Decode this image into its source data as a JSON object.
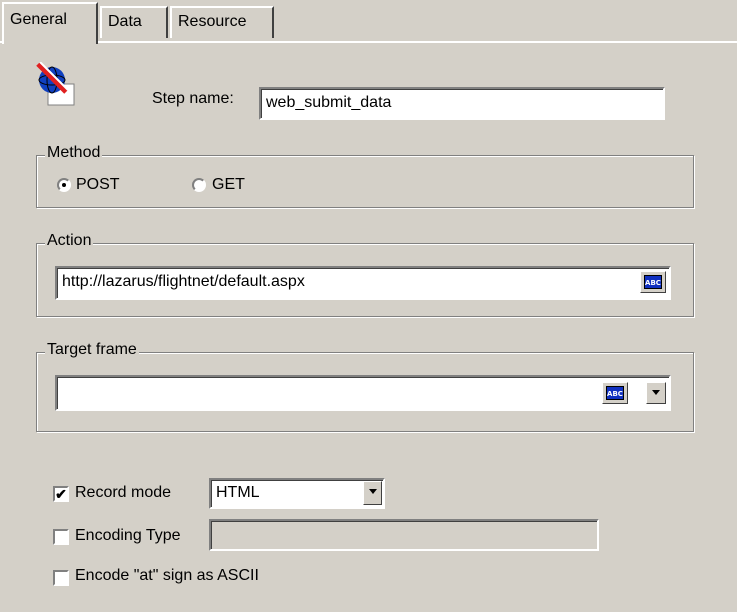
{
  "tabs": [
    "General",
    "Data",
    "Resource"
  ],
  "step": {
    "label": "Step name:",
    "value": "web_submit_data",
    "icon": "web-step-icon"
  },
  "method": {
    "legend": "Method",
    "options": [
      "POST",
      "GET"
    ],
    "selected": "POST"
  },
  "action": {
    "legend": "Action",
    "value": "http://lazarus/flightnet/default.aspx",
    "abc": "ABC"
  },
  "target_frame": {
    "legend": "Target frame",
    "value": "",
    "abc": "ABC"
  },
  "record_mode": {
    "label": "Record mode",
    "checked": true,
    "value": "HTML"
  },
  "encoding_type": {
    "label": "Encoding Type",
    "checked": false,
    "value": ""
  },
  "encode_at": {
    "label": "Encode \"at\" sign as ASCII",
    "checked": false
  },
  "check_mark": "✔",
  "colors": {
    "dialog_bg": "#d4d0c8",
    "abc_blue": "#1030c0"
  }
}
